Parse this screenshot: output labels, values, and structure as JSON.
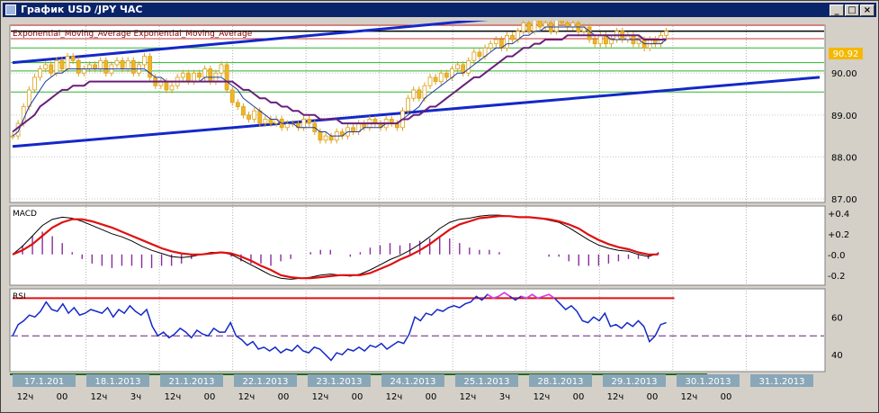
{
  "window": {
    "title": "График USD /JPY  ЧАС",
    "minimize_glyph": "_",
    "maximize_glyph": "□",
    "close_glyph": "×"
  },
  "chart_data": [
    {
      "type": "line",
      "name": "price-panel",
      "legend": "Exponential_Moving_Average Exponential_Moving_Average",
      "ylim": [
        87.0,
        91.1
      ],
      "y_ticks": [
        "90.00",
        "89.00",
        "88.00",
        "87.00"
      ],
      "last_price": "90.92",
      "x_range": [
        0,
        145
      ],
      "horizontal_lines": {
        "red": [
          91.14,
          90.82
        ],
        "black": [
          91.0
        ],
        "green": [
          90.6,
          90.25,
          90.05,
          89.55
        ]
      },
      "trendlines": [
        {
          "color": "#1428c8",
          "from": [
            0,
            90.25
          ],
          "to": [
            120,
            91.7
          ]
        },
        {
          "color": "#1428c8",
          "from": [
            0,
            88.25
          ],
          "to": [
            145,
            89.9
          ]
        }
      ],
      "close": [
        88.5,
        88.8,
        89.2,
        89.6,
        89.9,
        90.1,
        90.2,
        90.0,
        90.3,
        90.1,
        90.4,
        90.3,
        90.0,
        90.1,
        90.2,
        90.1,
        90.3,
        90.0,
        90.2,
        90.3,
        90.1,
        90.3,
        90.0,
        90.2,
        90.4,
        89.9,
        89.7,
        89.8,
        89.6,
        89.7,
        89.9,
        90.0,
        89.8,
        90.0,
        89.9,
        90.1,
        89.8,
        90.0,
        90.2,
        89.6,
        89.3,
        89.2,
        89.0,
        88.9,
        89.1,
        88.8,
        88.9,
        88.8,
        88.9,
        88.7,
        88.8,
        88.8,
        88.7,
        88.9,
        88.8,
        88.6,
        88.4,
        88.5,
        88.4,
        88.6,
        88.5,
        88.7,
        88.6,
        88.8,
        88.7,
        88.9,
        88.8,
        88.7,
        88.9,
        88.8,
        88.7,
        89.1,
        89.4,
        89.6,
        89.4,
        89.7,
        89.9,
        89.8,
        90.0,
        89.9,
        90.1,
        90.2,
        90.0,
        90.3,
        90.5,
        90.4,
        90.6,
        90.7,
        90.8,
        90.6,
        90.9,
        90.8,
        91.0,
        91.2,
        91.0,
        91.3,
        91.1,
        91.2,
        91.0,
        91.3,
        91.2,
        91.1,
        91.2,
        91.0,
        91.1,
        90.8,
        90.7,
        90.9,
        90.7,
        90.8,
        91.0,
        90.8,
        90.9,
        90.7,
        90.8,
        90.6,
        90.8,
        90.7,
        90.9,
        91.0
      ],
      "ema_fast": [
        88.5,
        88.6,
        88.9,
        89.2,
        89.4,
        89.6,
        89.8,
        89.9,
        90.0,
        90.0,
        90.1,
        90.1,
        90.1,
        90.1,
        90.1,
        90.1,
        90.1,
        90.1,
        90.1,
        90.1,
        90.1,
        90.1,
        90.1,
        90.1,
        90.1,
        90.0,
        89.9,
        89.9,
        89.8,
        89.8,
        89.8,
        89.8,
        89.8,
        89.8,
        89.8,
        89.9,
        89.9,
        89.9,
        89.9,
        89.8,
        89.7,
        89.6,
        89.4,
        89.3,
        89.2,
        89.1,
        89.0,
        88.9,
        88.9,
        88.8,
        88.8,
        88.8,
        88.7,
        88.7,
        88.7,
        88.7,
        88.6,
        88.6,
        88.5,
        88.5,
        88.5,
        88.6,
        88.6,
        88.6,
        88.7,
        88.7,
        88.7,
        88.7,
        88.8,
        88.8,
        88.8,
        88.9,
        89.0,
        89.1,
        89.2,
        89.4,
        89.5,
        89.6,
        89.7,
        89.8,
        89.9,
        90.0,
        90.0,
        90.1,
        90.2,
        90.3,
        90.4,
        90.5,
        90.6,
        90.6,
        90.7,
        90.7,
        90.8,
        90.9,
        90.9,
        91.0,
        91.0,
        91.1,
        91.1,
        91.1,
        91.1,
        91.1,
        91.1,
        91.1,
        91.1,
        91.0,
        90.9,
        90.9,
        90.9,
        90.8,
        90.8,
        90.8,
        90.8,
        90.8,
        90.8,
        90.7,
        90.7,
        90.7,
        90.7,
        90.8
      ],
      "ema_slow": [
        88.6,
        88.7,
        88.8,
        88.9,
        89.0,
        89.2,
        89.3,
        89.4,
        89.5,
        89.6,
        89.6,
        89.7,
        89.7,
        89.7,
        89.8,
        89.8,
        89.8,
        89.8,
        89.8,
        89.8,
        89.8,
        89.8,
        89.8,
        89.8,
        89.8,
        89.8,
        89.8,
        89.8,
        89.8,
        89.8,
        89.8,
        89.8,
        89.8,
        89.8,
        89.8,
        89.8,
        89.8,
        89.8,
        89.8,
        89.8,
        89.8,
        89.7,
        89.6,
        89.6,
        89.5,
        89.4,
        89.4,
        89.3,
        89.3,
        89.2,
        89.2,
        89.1,
        89.1,
        89.0,
        89.0,
        89.0,
        88.9,
        88.9,
        88.9,
        88.9,
        88.8,
        88.8,
        88.8,
        88.8,
        88.8,
        88.8,
        88.8,
        88.8,
        88.8,
        88.8,
        88.8,
        88.9,
        88.9,
        89.0,
        89.0,
        89.1,
        89.2,
        89.2,
        89.3,
        89.4,
        89.5,
        89.6,
        89.7,
        89.8,
        89.9,
        89.9,
        90.0,
        90.1,
        90.2,
        90.3,
        90.4,
        90.4,
        90.5,
        90.6,
        90.6,
        90.7,
        90.7,
        90.8,
        90.8,
        90.8,
        90.8,
        90.9,
        90.9,
        90.9,
        90.9,
        90.9,
        90.9,
        90.9,
        90.9,
        90.9,
        90.9,
        90.9,
        90.9,
        90.9,
        90.9,
        90.8,
        90.8,
        90.8,
        90.8,
        90.8
      ]
    },
    {
      "type": "line",
      "name": "macd-panel",
      "label": "MACD",
      "ylim": [
        -0.28,
        0.45
      ],
      "y_ticks": [
        "+0.4",
        "+0.2",
        "-0.0",
        "-0.2"
      ],
      "macd": [
        0.0,
        0.08,
        0.18,
        0.28,
        0.34,
        0.36,
        0.35,
        0.32,
        0.28,
        0.24,
        0.2,
        0.17,
        0.13,
        0.08,
        0.04,
        0.01,
        -0.02,
        -0.03,
        -0.02,
        0.0,
        0.02,
        0.02,
        0.0,
        -0.05,
        -0.1,
        -0.15,
        -0.2,
        -0.23,
        -0.24,
        -0.23,
        -0.22,
        -0.2,
        -0.19,
        -0.2,
        -0.21,
        -0.19,
        -0.15,
        -0.1,
        -0.05,
        -0.01,
        0.04,
        0.1,
        0.17,
        0.25,
        0.31,
        0.34,
        0.35,
        0.37,
        0.38,
        0.38,
        0.37,
        0.36,
        0.36,
        0.35,
        0.33,
        0.31,
        0.26,
        0.2,
        0.14,
        0.09,
        0.06,
        0.04,
        0.03,
        0.0,
        -0.02,
        0.01
      ],
      "signal": [
        0.0,
        0.04,
        0.1,
        0.18,
        0.26,
        0.31,
        0.34,
        0.34,
        0.32,
        0.29,
        0.26,
        0.22,
        0.18,
        0.14,
        0.1,
        0.06,
        0.03,
        0.01,
        0.0,
        0.0,
        0.01,
        0.02,
        0.01,
        -0.02,
        -0.06,
        -0.11,
        -0.15,
        -0.2,
        -0.22,
        -0.23,
        -0.23,
        -0.22,
        -0.21,
        -0.2,
        -0.2,
        -0.2,
        -0.18,
        -0.14,
        -0.1,
        -0.05,
        -0.01,
        0.04,
        0.1,
        0.17,
        0.24,
        0.29,
        0.32,
        0.35,
        0.36,
        0.37,
        0.37,
        0.36,
        0.36,
        0.35,
        0.34,
        0.32,
        0.29,
        0.25,
        0.19,
        0.14,
        0.1,
        0.07,
        0.05,
        0.02,
        0.0,
        0.0
      ]
    },
    {
      "type": "line",
      "name": "rsi-panel",
      "label": "RSI",
      "ylim": [
        32,
        74
      ],
      "y_ticks": [
        "60",
        "40"
      ],
      "levels": {
        "upper": 70,
        "mid": 50
      },
      "rsi": [
        50,
        56,
        58,
        61,
        60,
        63,
        68,
        64,
        63,
        67,
        62,
        65,
        61,
        62,
        64,
        63,
        62,
        65,
        60,
        64,
        62,
        66,
        63,
        61,
        64,
        55,
        50,
        52,
        49,
        51,
        54,
        52,
        49,
        53,
        51,
        50,
        54,
        52,
        52,
        57,
        50,
        48,
        45,
        47,
        43,
        44,
        42,
        44,
        41,
        43,
        42,
        45,
        42,
        41,
        44,
        43,
        40,
        37,
        41,
        40,
        43,
        42,
        44,
        42,
        45,
        44,
        46,
        43,
        45,
        47,
        46,
        51,
        60,
        58,
        62,
        61,
        64,
        63,
        65,
        66,
        65,
        67,
        68,
        71,
        69,
        72,
        70,
        71,
        73,
        71,
        69,
        71,
        70,
        72,
        70,
        71,
        72,
        70,
        67,
        64,
        66,
        63,
        58,
        57,
        60,
        58,
        62,
        55,
        56,
        54,
        57,
        55,
        58,
        55,
        47,
        50,
        56,
        57
      ]
    }
  ],
  "date_labels": [
    "17.1.201",
    "18.1.2013",
    "21.1.2013",
    "22.1.2013",
    "23.1.2013",
    "24.1.2013",
    "25.1.2013",
    "28.1.2013",
    "29.1.2013",
    "30.1.2013",
    "31.1.2013"
  ],
  "hour_labels": [
    "12ч",
    "00",
    "12ч",
    "3ч",
    "12ч",
    "00",
    "12ч",
    "00",
    "12ч",
    "00",
    "12ч",
    "00",
    "12ч",
    "3ч",
    "12ч",
    "00",
    "12ч",
    "00",
    "12ч",
    "00"
  ]
}
